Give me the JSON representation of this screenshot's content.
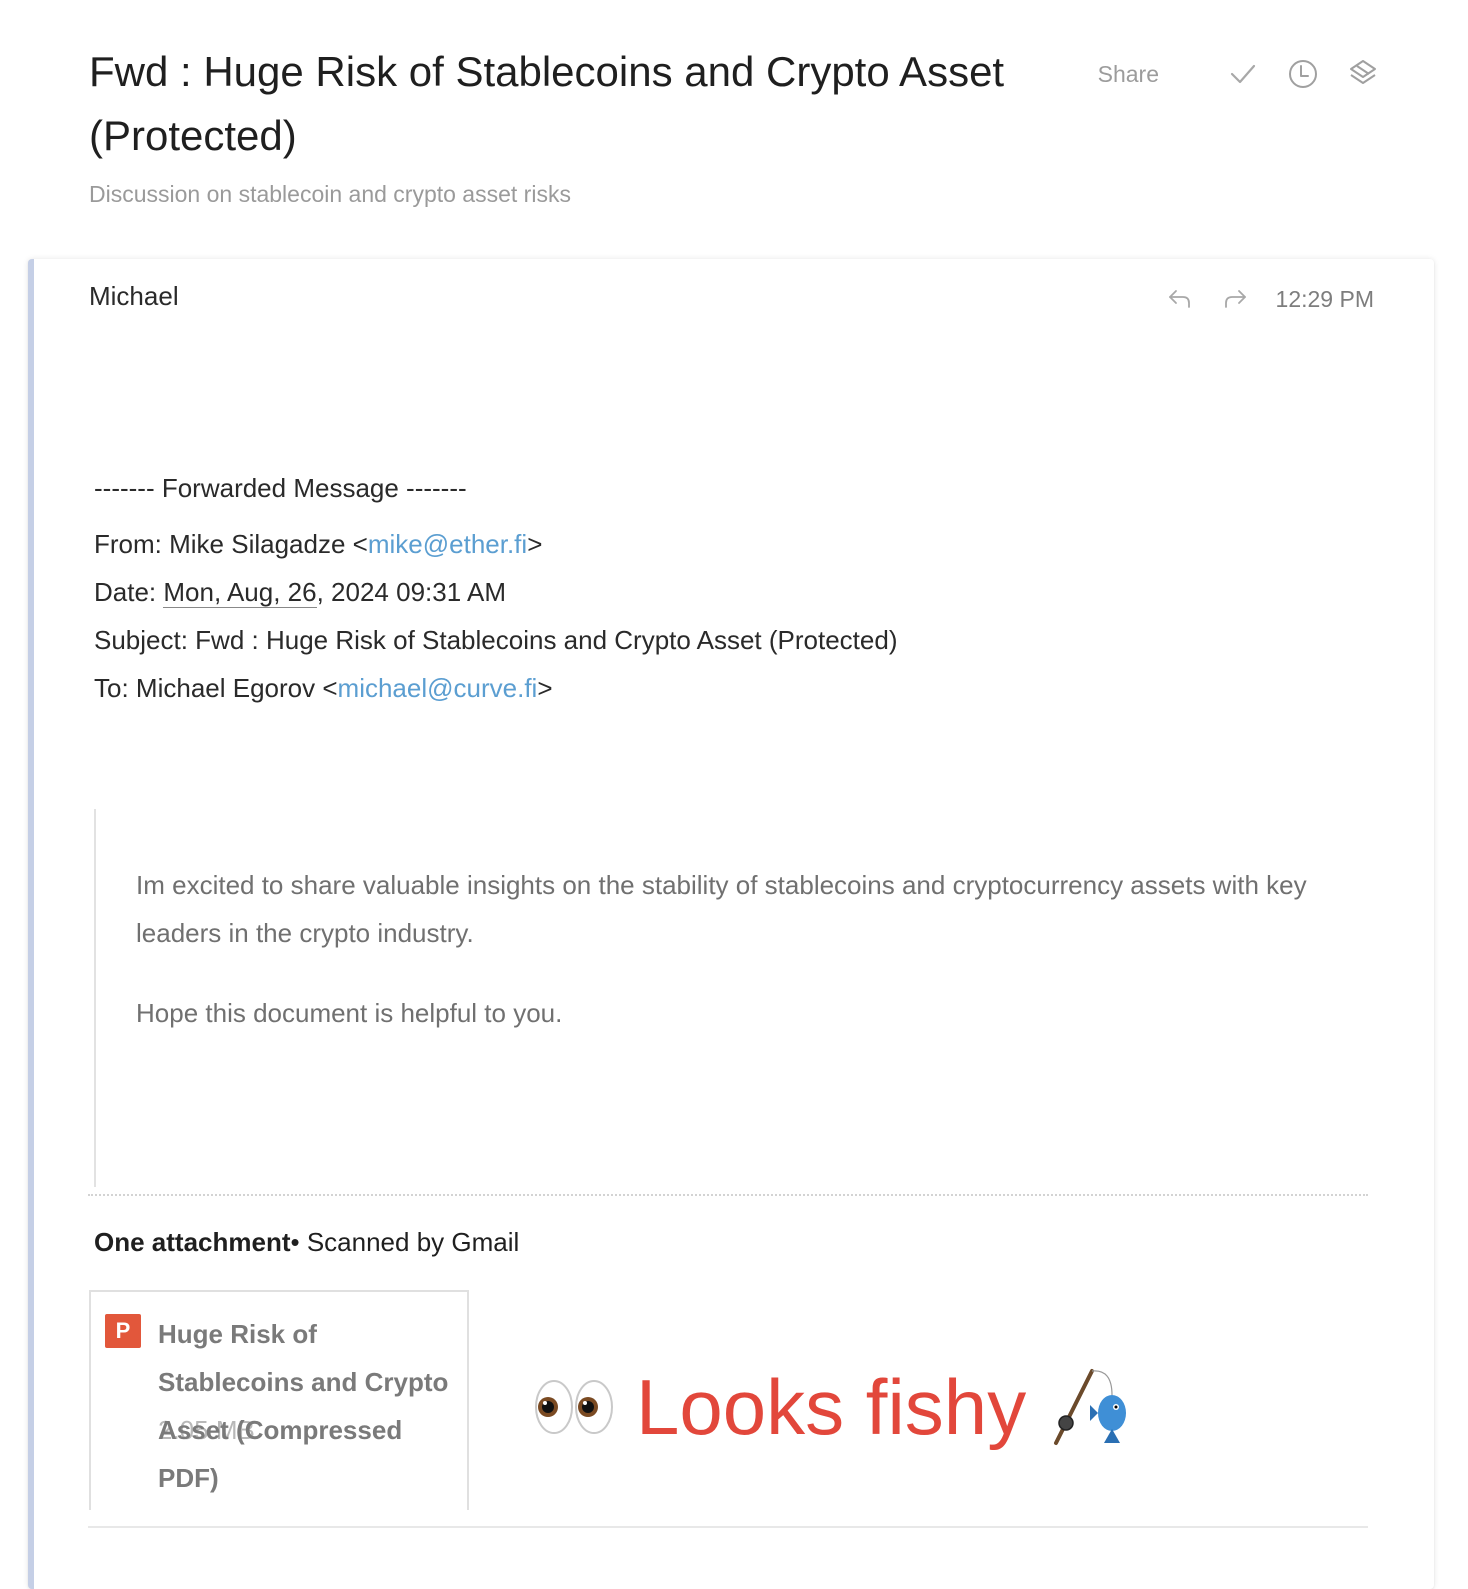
{
  "header": {
    "title": "Fwd : Huge Risk of Stablecoins and Crypto Asset (Protected)",
    "subtitle": "Discussion on stablecoin and crypto asset risks",
    "share_label": "Share",
    "icons": [
      "check-icon",
      "clock-icon",
      "layers-icon"
    ]
  },
  "message": {
    "sender": "Michael",
    "time": "12:29 PM",
    "icons": [
      "reply-icon",
      "forward-icon"
    ],
    "forwarded": {
      "separator": "------- Forwarded Message -------",
      "from_label": "From: ",
      "from_name": "Mike Silagadze <",
      "from_email": "mike@ether.fi",
      "from_suffix": ">",
      "date_label": "Date: ",
      "date_underlined": "Mon, Aug, 26",
      "date_rest": ", 2024 09:31 AM",
      "subject_line": "Subject: Fwd : Huge Risk of Stablecoins and Crypto Asset (Protected)",
      "to_label": "To: ",
      "to_name": "Michael Egorov <",
      "to_email": "michael@curve.fi",
      "to_suffix": ">"
    },
    "body": {
      "paragraph1": "Im excited to share valuable insights on the stability of stablecoins and cryptocurrency assets with key leaders in the crypto industry.",
      "paragraph2": "Hope this document is helpful to you."
    },
    "attachments": {
      "count_label": "One attachment",
      "scan_label": "• Scanned by Gmail",
      "items": [
        {
          "type_badge": "P",
          "name": "Huge Risk of Stablecoins and Crypto Asset (Compressed PDF)",
          "size": "2.05 MB"
        }
      ]
    }
  },
  "annotation": {
    "text": "Looks fishy",
    "color": "#e2473b",
    "icons": [
      "eyes-icon",
      "fishing-pole-icon"
    ]
  },
  "colors": {
    "link": "#5b9ed1",
    "accent_border": "#c5cfe6",
    "pdf_badge": "#e2573b"
  }
}
